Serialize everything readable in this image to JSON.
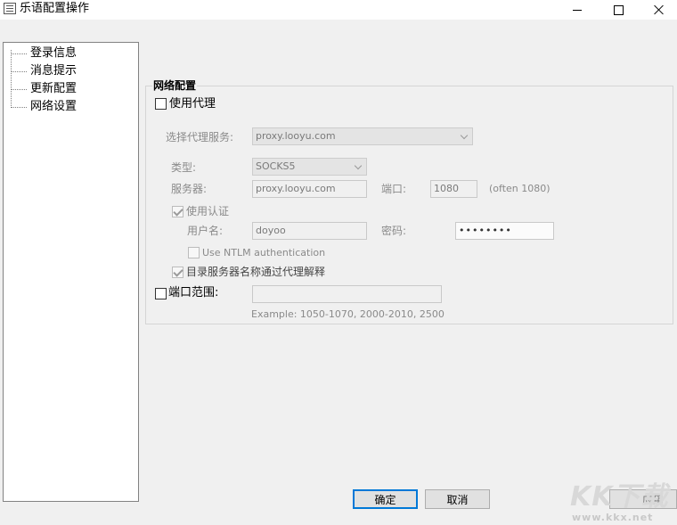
{
  "window": {
    "title": "乐语配置操作",
    "icon": "app-config-icon"
  },
  "tree": {
    "items": [
      {
        "label": "登录信息"
      },
      {
        "label": "消息提示"
      },
      {
        "label": "更新配置"
      },
      {
        "label": "网络设置"
      }
    ],
    "selected": "网络设置"
  },
  "network": {
    "group_title": "网络配置",
    "use_proxy_label": "使用代理",
    "use_proxy_checked": false,
    "select_service_label": "选择代理服务:",
    "select_service_value": "proxy.looyu.com",
    "type_label": "类型:",
    "type_value": "SOCKS5",
    "server_label": "服务器:",
    "server_value": "proxy.looyu.com",
    "port_label": "端口:",
    "port_value": "1080",
    "port_hint": "(often 1080)",
    "use_auth_label": "使用认证",
    "use_auth_checked": true,
    "username_label": "用户名:",
    "username_value": "doyoo",
    "password_label": "密码:",
    "password_value": "••••••••",
    "ntlm_label": "Use NTLM authentication",
    "ntlm_checked": false,
    "dns_label": "目录服务器名称通过代理解释",
    "dns_checked": true,
    "port_range_label": "端口范围:",
    "port_range_checked": false,
    "port_range_value": "",
    "port_range_example": "Example: 1050-1070, 2000-2010, 2500"
  },
  "buttons": {
    "ok": "确定",
    "cancel": "取消",
    "apply": "应用"
  },
  "watermark": {
    "logo": "KK下载",
    "url": "www.kkx.net"
  }
}
